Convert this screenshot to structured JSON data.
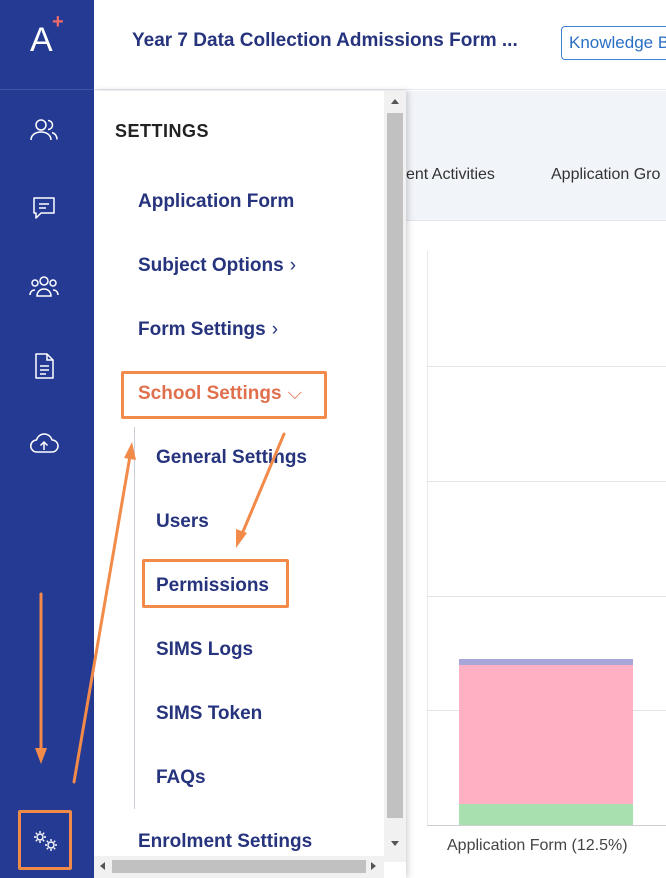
{
  "rail": {
    "logo_letter": "A",
    "logo_plus": "+",
    "icons": [
      "users-icon",
      "message-icon",
      "group-icon",
      "document-icon",
      "cloud-upload-icon",
      "settings-gears-icon"
    ]
  },
  "header": {
    "title": "Year 7 Data Collection Admissions Form ...",
    "knowledge_button": "Knowledge B"
  },
  "content": {
    "tabs": [
      "cent Activities",
      "Application Gro"
    ],
    "axis_label": "Application Form (12.5%)"
  },
  "chart_data": {
    "type": "bar",
    "categories": [
      "Application Form (12.5%)"
    ],
    "series": [
      {
        "values": [
          0.7
        ]
      },
      {
        "values": [
          5.5
        ]
      },
      {
        "values": [
          0.8
        ]
      }
    ]
  },
  "settings_menu": {
    "heading": "SETTINGS",
    "items": {
      "application_form": "Application Form",
      "subject_options": "Subject Options",
      "form_settings": "Form Settings",
      "school_settings": "School Settings",
      "enrolment_settings": "Enrolment Settings"
    },
    "school_settings_sub": {
      "general_settings": "General Settings",
      "users": "Users",
      "permissions": "Permissions",
      "sims_logs": "SIMS Logs",
      "sims_token": "SIMS Token",
      "faqs": "FAQs"
    },
    "chevron_right": "›",
    "chevron_down": "⌵"
  },
  "colors": {
    "rail_bg": "#253a93",
    "title_text": "#26337d",
    "active_item": "#e0704d",
    "annotation": "#f28a4a"
  }
}
